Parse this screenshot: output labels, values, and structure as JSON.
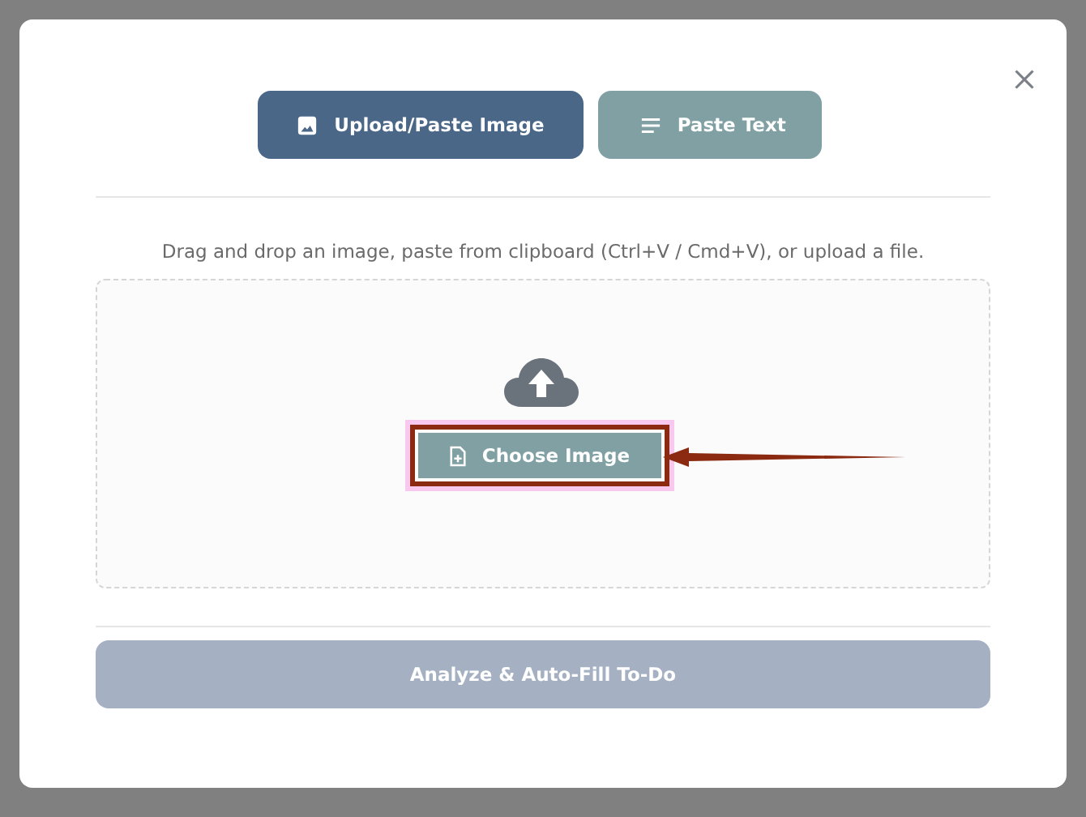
{
  "tabs": [
    {
      "label": "Upload/Paste Image",
      "selected": true
    },
    {
      "label": "Paste Text",
      "selected": false
    }
  ],
  "hint": "Drag and drop an image, paste from clipboard (Ctrl+V / Cmd+V), or upload a file.",
  "dropzone": {
    "button": "Choose Image",
    "highlighted": true
  },
  "analyze": {
    "label": "Analyze & Auto-Fill To-Do",
    "disabled": true
  }
}
